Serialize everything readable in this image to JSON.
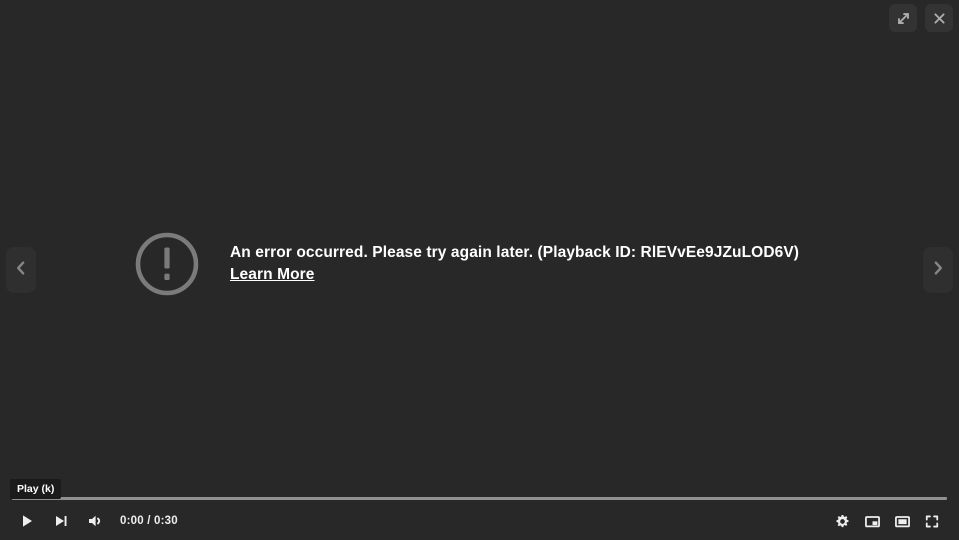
{
  "player": {
    "background_color": "#282828",
    "top_controls": [
      {
        "name": "expand-button",
        "icon": "expand-arrows-icon",
        "label": "Expand"
      },
      {
        "name": "close-button",
        "icon": "close-icon",
        "label": "Close"
      }
    ],
    "navigation": {
      "previous": {
        "icon": "chevron-left-icon",
        "label": "Previous"
      },
      "next": {
        "icon": "chevron-right-icon",
        "label": "Next"
      }
    }
  },
  "error": {
    "icon": "error-exclamation-circle-icon",
    "message": "An error occurred. Please try again later. (Playback ID: RlEVvEe9JZuLOD6V)",
    "playback_id": "RlEVvEe9JZuLOD6V",
    "link_label": "Learn More",
    "text_color": "#ffffff",
    "icon_color": "#7b7b7b"
  },
  "tooltip": {
    "text": "Play (k)"
  },
  "controls": {
    "progress": {
      "value_percent": 0,
      "track_color": "#909090"
    },
    "left": [
      {
        "name": "play-button",
        "icon": "play-icon",
        "label": "Play"
      },
      {
        "name": "next-video-button",
        "icon": "next-track-icon",
        "label": "Next"
      },
      {
        "name": "volume-button",
        "icon": "volume-icon",
        "label": "Mute"
      }
    ],
    "time": {
      "current": "0:00",
      "duration": "0:30",
      "display": "0:00 / 0:30"
    },
    "right": [
      {
        "name": "settings-button",
        "icon": "gear-icon",
        "label": "Settings"
      },
      {
        "name": "miniplayer-button",
        "icon": "miniplayer-icon",
        "label": "Miniplayer"
      },
      {
        "name": "theater-button",
        "icon": "theater-mode-icon",
        "label": "Theater mode"
      },
      {
        "name": "fullscreen-button",
        "icon": "fullscreen-icon",
        "label": "Full screen"
      }
    ]
  }
}
